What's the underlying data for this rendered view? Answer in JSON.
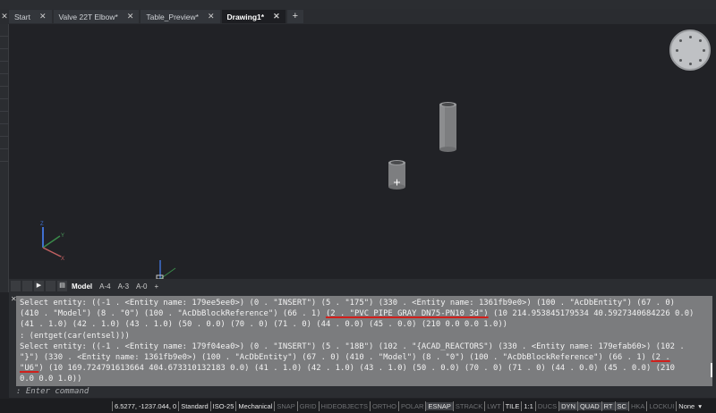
{
  "tabs": [
    {
      "label": "Start",
      "active": false
    },
    {
      "label": "Valve 22T Elbow*",
      "active": false
    },
    {
      "label": "Table_Preview*",
      "active": false
    },
    {
      "label": "Drawing1*",
      "active": true
    }
  ],
  "tab_close": "✕",
  "tab_add": "+",
  "axes": {
    "x": "X",
    "y": "Y",
    "z": "Z"
  },
  "layout_tabs": [
    "Model",
    "A-4",
    "A-3",
    "A-0"
  ],
  "layout_add": "+",
  "command_history": [
    [
      {
        "t": "Select entity: ((-1 . <Entity name: 179ee5ee0>) (0 . \"INSERT\") (5 . \"175\") (330 . <Entity name: 1361fb9e0>) (100 . \"AcDbEntity\") (67 . 0)"
      }
    ],
    [
      {
        "t": "(410 . \"Model\") (8 . \"0\") (100 . \"AcDbBlockReference\") (66 . 1) "
      },
      {
        "t": "(2 . \"PVC PIPE GRAY DN75-PN10 3d\")",
        "mark": true
      },
      {
        "t": " (10 214.953845179534 40.5927340684226 0.0)"
      }
    ],
    [
      {
        "t": "(41 . 1.0) (42 . 1.0) (43 . 1.0) (50 . 0.0) (70 . 0) (71 . 0) (44 . 0.0) (45 . 0.0) (210 0.0 0.0 1.0))"
      }
    ],
    [
      {
        "t": ": (entget(car(entsel)))"
      }
    ],
    [
      {
        "t": "Select entity: ((-1 . <Entity name: 179f04ea0>) (0 . \"INSERT\") (5 . \"18B\") (102 . \"{ACAD_REACTORS\") (330 . <Entity name: 179efab60>) (102 ."
      }
    ],
    [
      {
        "t": "\"}\") (330 . <Entity name: 1361fb9e0>) (100 . \"AcDbEntity\") (67 . 0) (410 . \"Model\") (8 . \"0\") (100 . \"AcDbBlockReference\") (66 . 1) "
      },
      {
        "t": "(2 .",
        "mark": true
      }
    ],
    [
      {
        "t": "\"U6\"",
        "mark": true
      },
      {
        "t": ") (10 169.724791613664 404.673310132183 0.0) (41 . 1.0) (42 . 1.0) (43 . 1.0) (50 . 0.0) (70 . 0) (71 . 0) (44 . 0.0) (45 . 0.0) (210"
      }
    ],
    [
      {
        "t": "0.0 0.0 1.0))"
      }
    ]
  ],
  "command_placeholder": ": Enter command",
  "status": {
    "coords": "6.5277, -1237.044, 0",
    "items": [
      {
        "label": "Standard",
        "on": true
      },
      {
        "label": "ISO-25",
        "on": true
      },
      {
        "label": "Mechanical",
        "on": true
      },
      {
        "label": "SNAP",
        "on": false
      },
      {
        "label": "GRID",
        "on": false
      },
      {
        "label": "HIDEOBJECTS",
        "on": false
      },
      {
        "label": "ORTHO",
        "on": false
      },
      {
        "label": "POLAR",
        "on": false
      },
      {
        "label": "ESNAP",
        "on": true,
        "hl": true
      },
      {
        "label": "STRACK",
        "on": false
      },
      {
        "label": "LWT",
        "on": false
      },
      {
        "label": "TILE",
        "on": true
      },
      {
        "label": "1:1",
        "on": true
      },
      {
        "label": "DUCS",
        "on": false
      },
      {
        "label": "DYN",
        "on": true,
        "hl": true
      },
      {
        "label": "QUAD",
        "on": true,
        "hl": true
      },
      {
        "label": "RT",
        "on": true,
        "hl": true
      },
      {
        "label": "SC",
        "on": true,
        "hl": true
      },
      {
        "label": "HKA",
        "on": false
      },
      {
        "label": "LOCKUI",
        "on": false
      },
      {
        "label": "None",
        "on": true
      }
    ],
    "dropdown": "▾"
  }
}
